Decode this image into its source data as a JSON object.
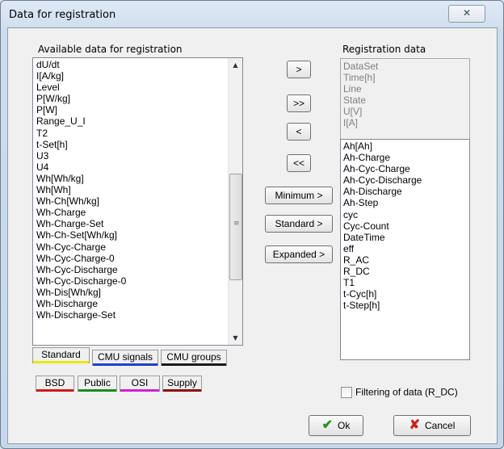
{
  "window": {
    "title": "Data for registration",
    "close_glyph": "✕"
  },
  "available": {
    "label": "Available data for registration",
    "items": [
      "dU/dt",
      "I[A/kg]",
      "Level",
      "P[W/kg]",
      "P[W]",
      "Range_U_I",
      "T2",
      "t-Set[h]",
      "U3",
      "U4",
      "Wh[Wh/kg]",
      "Wh[Wh]",
      "Wh-Ch[Wh/kg]",
      "Wh-Charge",
      "Wh-Charge-Set",
      "Wh-Ch-Set[Wh/kg]",
      "Wh-Cyc-Charge",
      "Wh-Cyc-Charge-0",
      "Wh-Cyc-Discharge",
      "Wh-Cyc-Discharge-0",
      "Wh-Dis[Wh/kg]",
      "Wh-Discharge",
      "Wh-Discharge-Set"
    ]
  },
  "move_buttons": {
    "add": ">",
    "add_all": ">>",
    "remove": "<",
    "remove_all": "<<"
  },
  "preset_buttons": {
    "minimum": "Minimum >",
    "standard": "Standard >",
    "expanded": "Expanded >"
  },
  "registration": {
    "label": "Registration data",
    "fixed_items": [
      "DataSet",
      "Time[h]",
      "Line",
      "State",
      "U[V]",
      "I[A]"
    ],
    "items": [
      "Ah[Ah]",
      "Ah-Charge",
      "Ah-Cyc-Charge",
      "Ah-Cyc-Discharge",
      "Ah-Discharge",
      "Ah-Step",
      "cyc",
      "Cyc-Count",
      "DateTime",
      "eff",
      "R_AC",
      "R_DC",
      "T1",
      "t-Cyc[h]",
      "t-Step[h]"
    ]
  },
  "tabs": {
    "standard": "Standard",
    "cmu_signals": "CMU signals",
    "cmu_groups": "CMU groups",
    "bsd": "BSD",
    "public": "Public",
    "osi": "OSI",
    "supply": "Supply"
  },
  "tab_colors": {
    "standard": "#e8e800",
    "cmu_signals": "#1f3fd0",
    "cmu_groups": "#1a1a1a",
    "bsd": "#d01818",
    "public": "#1a8a1a",
    "osi": "#d020d0",
    "supply": "#8a1010"
  },
  "filter": {
    "label": "Filtering of data (R_DC)",
    "checked": false
  },
  "footer": {
    "ok": "Ok",
    "cancel": "Cancel"
  },
  "icons": {
    "ok": "check-icon",
    "cancel": "x-icon"
  }
}
